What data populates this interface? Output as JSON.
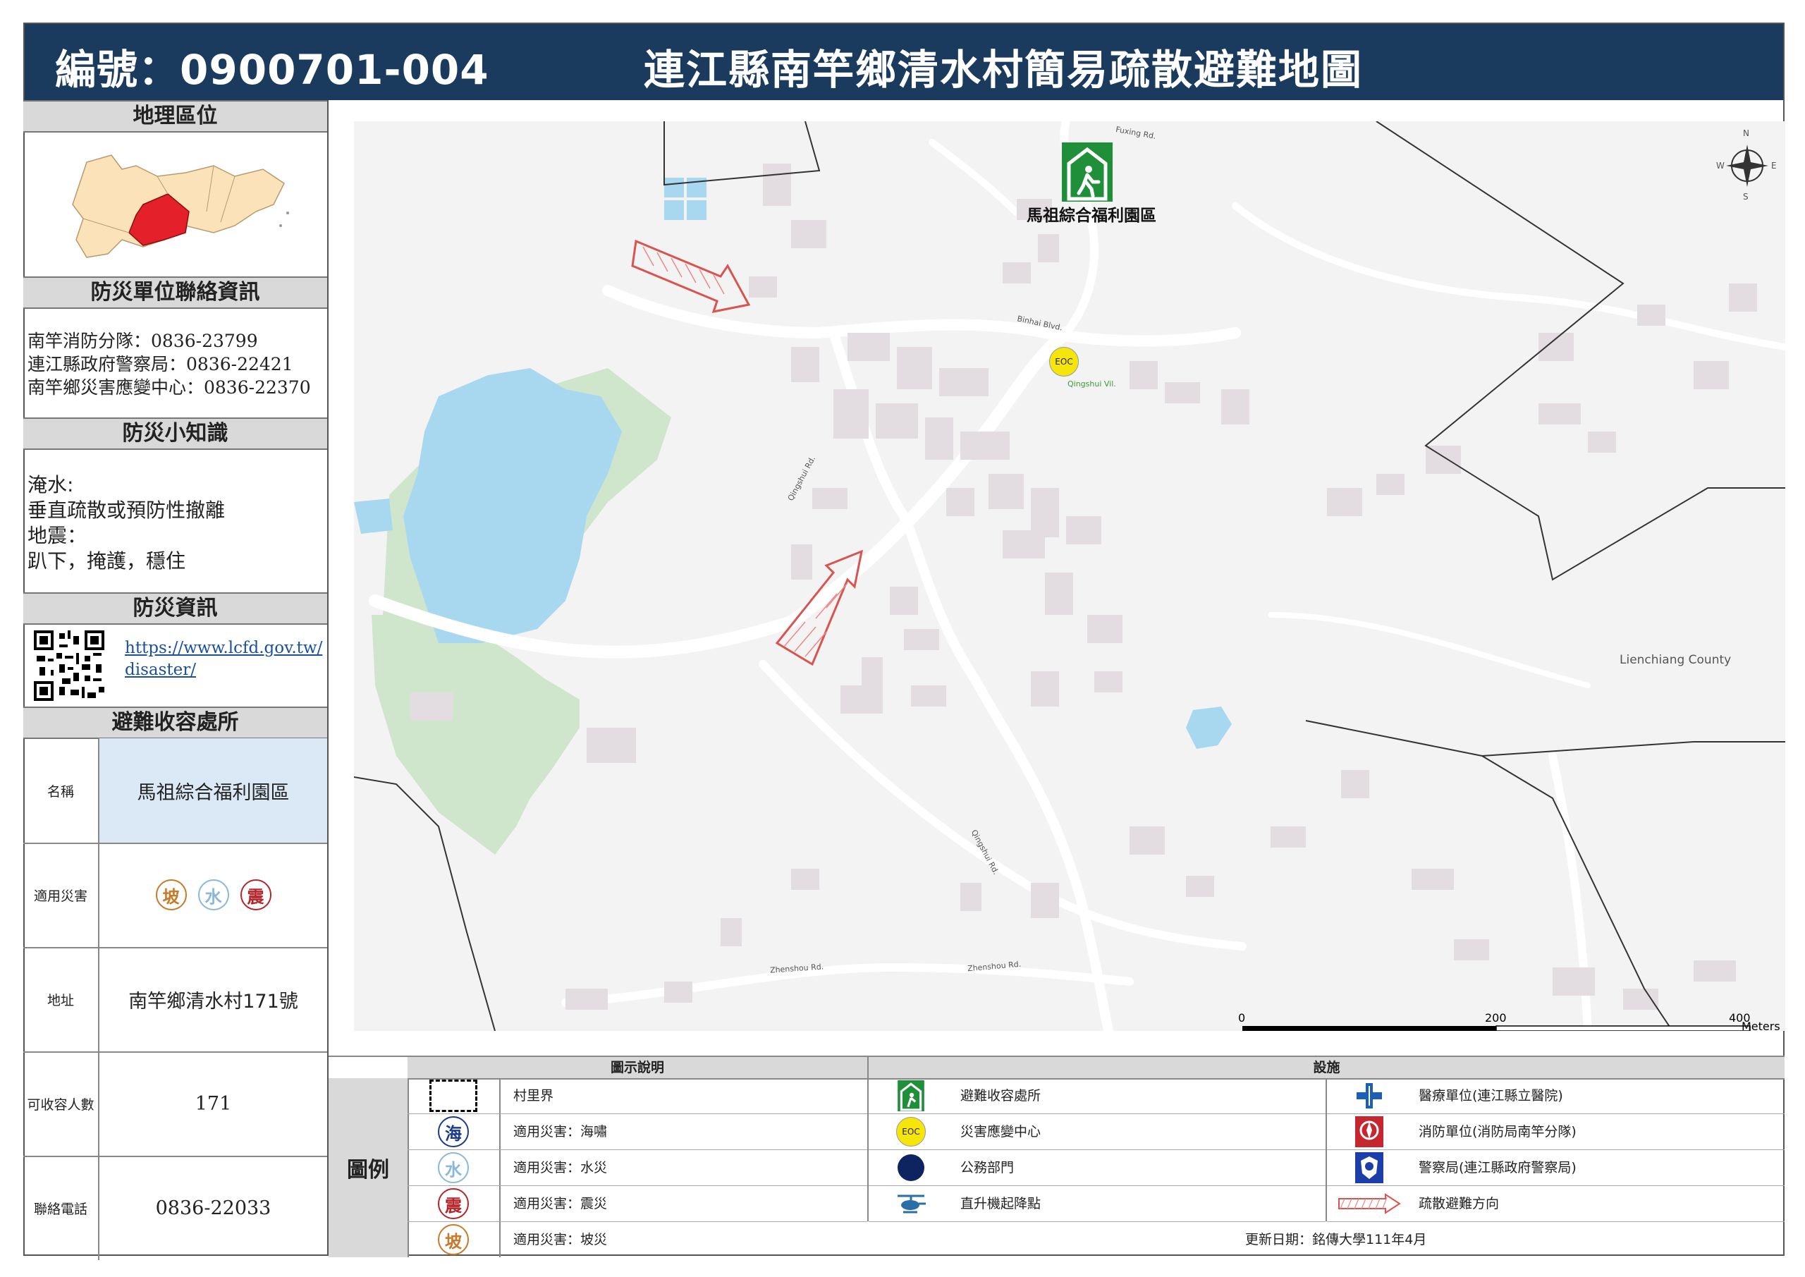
{
  "header": {
    "code": "編號：0900701-004",
    "title": "連江縣南竿鄉清水村簡易疏散避難地圖"
  },
  "sections": {
    "location": "地理區位",
    "contacts_title": "防災單位聯絡資訊",
    "tips_title": "防災小知識",
    "info_title": "防災資訊",
    "shelter_title": "避難收容處所"
  },
  "contacts": [
    "南竿消防分隊：0836-23799",
    "連江縣政府警察局：0836-22421",
    "南竿鄉災害應變中心：0836-22370"
  ],
  "tips": [
    "淹水:",
    "垂直疏散或預防性撤離",
    "地震：",
    "趴下，掩護，穩住"
  ],
  "info": {
    "link_line1": "https://www.lcfd.gov.tw/",
    "link_line2": "disaster/"
  },
  "shelter": {
    "name_label": "名稱",
    "name": "馬祖綜合福利園區",
    "hazards_label": "適用災害",
    "hazards": [
      "坡",
      "水",
      "震"
    ],
    "address_label": "地址",
    "address": "南竿鄉清水村171號",
    "capacity_label": "可收容人數",
    "capacity": "171",
    "phone_label": "聯絡電話",
    "phone": "0836-22033"
  },
  "map": {
    "shelter_label": "馬祖綜合福利園區",
    "eoc": "EOC",
    "county_label": "Lienchiang County",
    "village_label": "Qingshui Vil.",
    "roads": [
      "Binhai Blvd.",
      "Qingshui Rd.",
      "Zhenshou Rd.",
      "Fuxing Rd."
    ],
    "compass": {
      "n": "N",
      "s": "S",
      "e": "E",
      "w": "W"
    },
    "scale": {
      "t0": "0",
      "t1": "200",
      "t2": "400",
      "unit": "Meters"
    }
  },
  "legend": {
    "side": "圖例",
    "map_header": "圖示說明",
    "facility_header": "設施",
    "map_items": [
      "村里界",
      "適用災害：海嘯",
      "適用災害：水災",
      "適用災害：震災",
      "適用災害：坡災"
    ],
    "map_glyphs": [
      "海",
      "水",
      "震",
      "坡"
    ],
    "facility_items": [
      "避難收容處所",
      "災害應變中心",
      "公務部門",
      "直升機起降點"
    ],
    "facility_items2": [
      "醫療單位(連江縣立醫院)",
      "消防單位(消防局南竿分隊)",
      "警察局(連江縣政府警察局)",
      "疏散避難方向"
    ],
    "updated": "更新日期：銘傳大學111年4月"
  },
  "colors": {
    "header_bg": "#1a3a5e",
    "shelter_green": "#1f8f3a",
    "eoc_yellow": "#f5e50a",
    "water": "#a8d8ef",
    "park": "#cfe5cc",
    "arrow": "#d9534f"
  }
}
